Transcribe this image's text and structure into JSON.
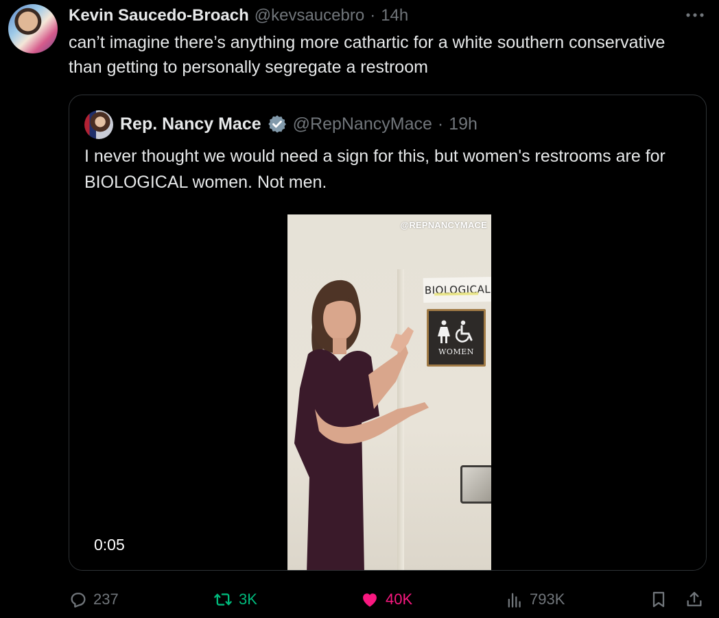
{
  "post": {
    "author_name": "Kevin Saucedo-Broach",
    "author_handle": "@kevsaucebro",
    "separator": "·",
    "time": "14h",
    "text": "can’t imagine there’s anything more cathartic for a white southern conservative than getting to personally segregate a restroom"
  },
  "quote": {
    "author_name": "Rep. Nancy Mace",
    "author_handle": "@RepNancyMace",
    "separator": "·",
    "time": "19h",
    "text": "I never thought we would need a sign for this, but women's restrooms are for BIOLOGICAL women. Not men.",
    "video": {
      "watermark": "@REPNANCYMACE",
      "sign_handwritten": "BIOLOGICAL",
      "sign_plaque": "WOMEN",
      "timestamp": "0:05"
    }
  },
  "actions": {
    "replies": "237",
    "reposts": "3K",
    "likes": "40K",
    "views": "793K"
  },
  "colors": {
    "background": "#000000",
    "text_primary": "#e7e9ea",
    "text_secondary": "#71767b",
    "border": "#2f3336",
    "repost_active": "#00ba7c",
    "like_active": "#f91880",
    "verified": "#829aab"
  },
  "icons": [
    "more-icon",
    "verified-icon",
    "reply-icon",
    "repost-icon",
    "like-icon",
    "views-icon",
    "bookmark-icon",
    "share-icon"
  ]
}
